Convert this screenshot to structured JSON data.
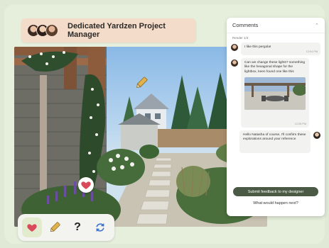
{
  "header": {
    "title": "Dedicated Yardzen Project Manager"
  },
  "comments": {
    "title": "Comments",
    "collapse_icon": "chevron-up-icon",
    "thread_label": "Render 1/3",
    "messages": [
      {
        "author": "user",
        "text": "I like this pergola!",
        "time": "12:04 PM"
      },
      {
        "author": "user",
        "text": "Can we change these lights? something like the hexagonal shape for the lightbox, keen found one like this",
        "time": "12:05 PM"
      },
      {
        "author": "designer",
        "text": "Hello Natasha of course, I'll confirm these explorations around your reference",
        "time": ""
      }
    ],
    "submit_label": "Submit feedback to my designer",
    "link_label": "What would happen next?"
  },
  "toolbar": {
    "items": [
      {
        "icon": "heart-icon",
        "active": true
      },
      {
        "icon": "pencil-icon",
        "active": false
      },
      {
        "icon": "question-icon",
        "label": "?",
        "active": false
      },
      {
        "icon": "refresh-icon",
        "active": false
      }
    ]
  },
  "colors": {
    "accent": "#4b5a44",
    "heart": "#d94a5a",
    "pencil": "#d9a33a",
    "pill": "#f4dccb"
  }
}
